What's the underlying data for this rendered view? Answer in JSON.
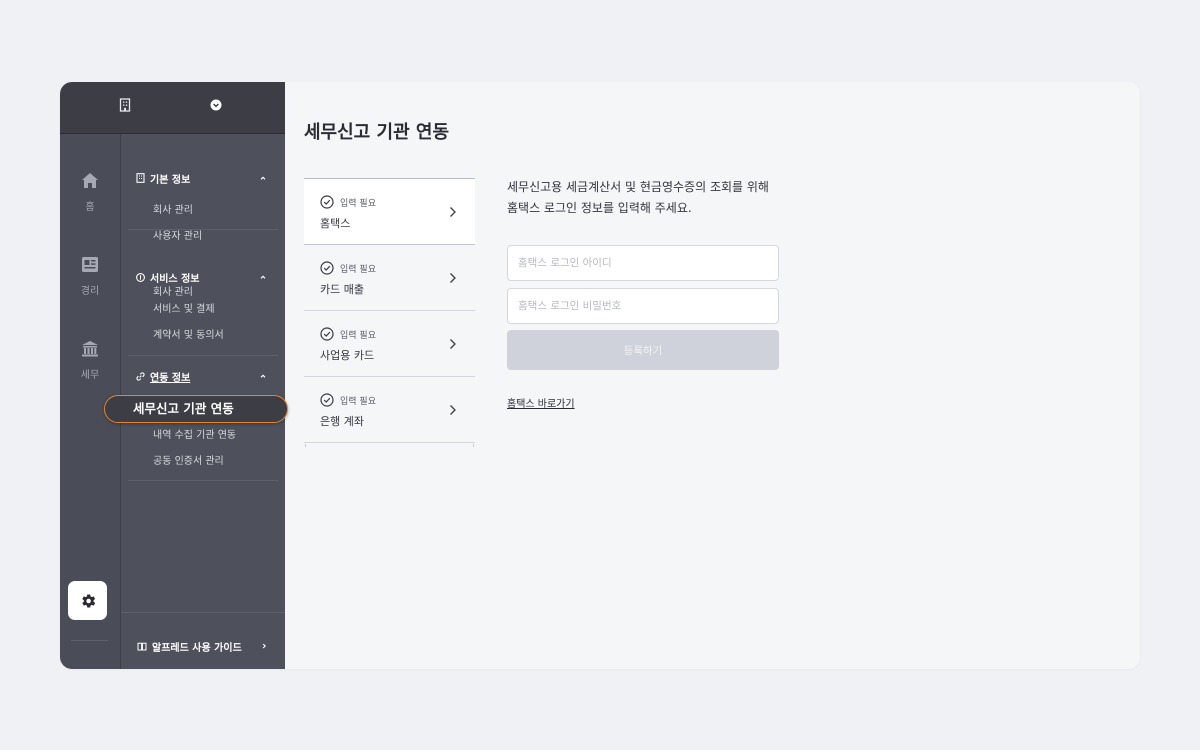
{
  "sidebar": {
    "rail": [
      {
        "label": "홈",
        "icon": "home-icon"
      },
      {
        "label": "경리",
        "icon": "ledger-icon"
      },
      {
        "label": "세무",
        "icon": "bank-icon"
      }
    ],
    "sections": [
      {
        "title": "기본 정보",
        "icon": "building-icon",
        "items": [
          "회사 관리",
          "사용자 관리"
        ]
      },
      {
        "title": "서비스 정보",
        "icon": "coin-icon",
        "items": [
          "서비스 및 결제",
          "계약서 및 동의서"
        ]
      },
      {
        "title": "연동 정보",
        "icon": "link-icon",
        "items": [
          "세무신고 기관 연동",
          "내역 수집 기관 연동",
          "공동 인증서 관리"
        ]
      }
    ],
    "active_item": "세무신고 기관 연동",
    "guide_label": "알프레드 사용 가이드"
  },
  "main": {
    "title": "세무신고 기관 연동",
    "steps": [
      {
        "status": "입력 필요",
        "label": "홈택스"
      },
      {
        "status": "입력 필요",
        "label": "카드 매출"
      },
      {
        "status": "입력 필요",
        "label": "사업용 카드"
      },
      {
        "status": "입력 필요",
        "label": "은행 계좌"
      }
    ],
    "description_line1": "세무신고용 세금계산서 및 현금영수증의 조회를 위해",
    "description_line2": "홈택스 로그인 정보를 입력해 주세요.",
    "id_placeholder": "홈택스 로그인 아이디",
    "password_placeholder": "홈택스 로그인 비밀번호",
    "submit_label": "등록하기",
    "hometax_link": "홈택스 바로가기"
  },
  "colors": {
    "accent_orange": "#e5862c",
    "sidebar_dark": "#3c3d45",
    "nav_bg": "#4e505c",
    "disabled_button": "#cfd1db"
  }
}
